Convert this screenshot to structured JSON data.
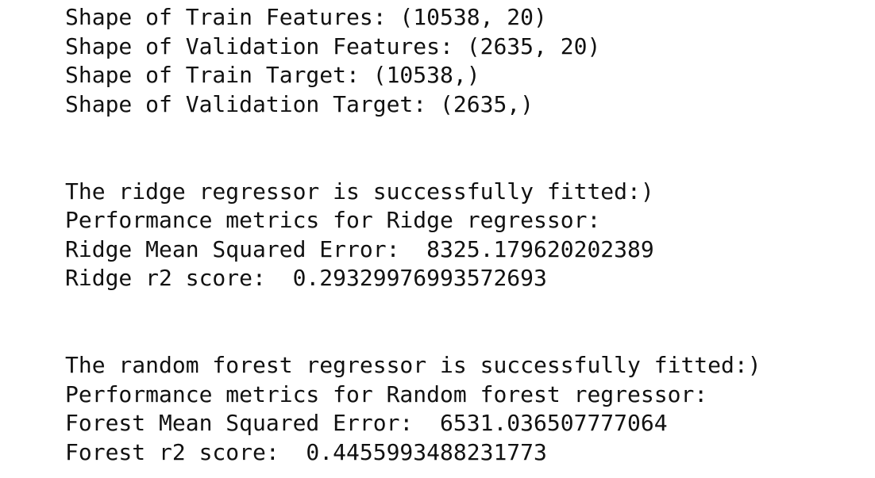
{
  "shapes": {
    "train_features": "Shape of Train Features: (10538, 20)",
    "validation_features": "Shape of Validation Features: (2635, 20)",
    "train_target": "Shape of Train Target: (10538,)",
    "validation_target": "Shape of Validation Target: (2635,)"
  },
  "ridge": {
    "fitted": "The ridge regressor is successfully fitted:)",
    "metrics_header": "Performance metrics for Ridge regressor:",
    "mse": "Ridge Mean Squared Error:  8325.179620202389",
    "r2": "Ridge r2 score:  0.29329976993572693"
  },
  "forest": {
    "fitted": "The random forest regressor is successfully fitted:)",
    "metrics_header": "Performance metrics for Random forest regressor:",
    "mse": "Forest Mean Squared Error:  6531.036507777064",
    "r2": "Forest r2 score:  0.4455993488231773"
  }
}
